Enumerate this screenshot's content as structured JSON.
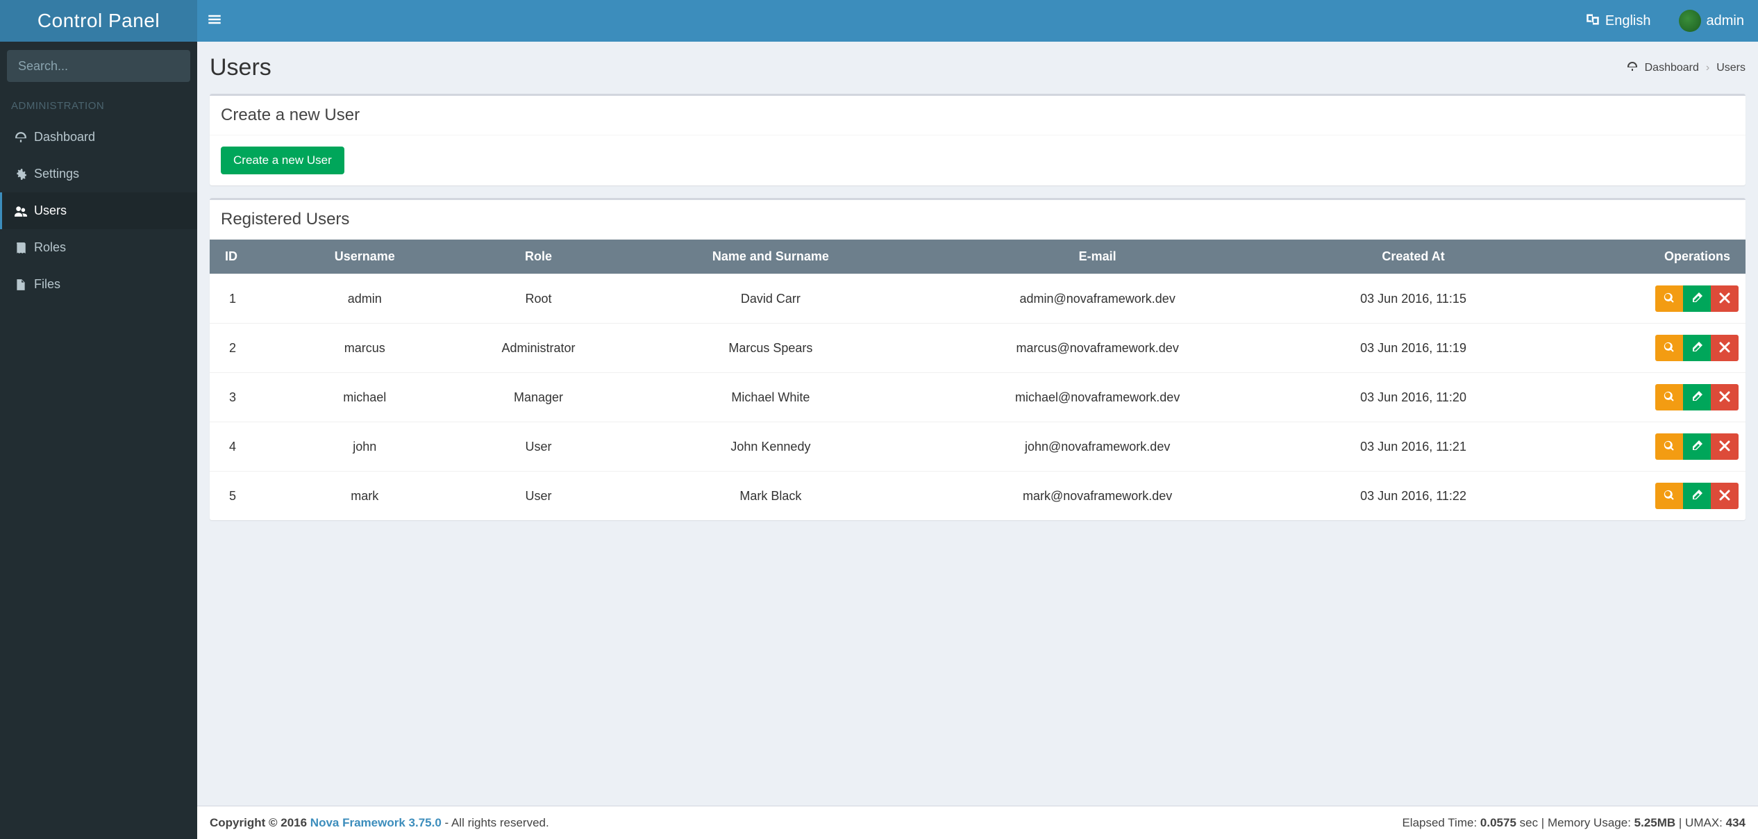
{
  "brand": "Control Panel",
  "search": {
    "placeholder": "Search..."
  },
  "sidebar": {
    "section": "ADMINISTRATION",
    "items": [
      {
        "label": "Dashboard",
        "icon": "dashboard"
      },
      {
        "label": "Settings",
        "icon": "gear"
      },
      {
        "label": "Users",
        "icon": "users",
        "active": true
      },
      {
        "label": "Roles",
        "icon": "book"
      },
      {
        "label": "Files",
        "icon": "file"
      }
    ]
  },
  "topbar": {
    "language": "English",
    "username": "admin"
  },
  "page": {
    "title": "Users",
    "breadcrumb": {
      "dashboard": "Dashboard",
      "current": "Users"
    }
  },
  "create_box": {
    "title": "Create a new User",
    "button": "Create a new User"
  },
  "table_box": {
    "title": "Registered Users",
    "columns": [
      "ID",
      "Username",
      "Role",
      "Name and Surname",
      "E-mail",
      "Created At",
      "Operations"
    ],
    "rows": [
      {
        "id": "1",
        "username": "admin",
        "role": "Root",
        "name": "David Carr",
        "email": "admin@novaframework.dev",
        "created": "03 Jun 2016, 11:15"
      },
      {
        "id": "2",
        "username": "marcus",
        "role": "Administrator",
        "name": "Marcus Spears",
        "email": "marcus@novaframework.dev",
        "created": "03 Jun 2016, 11:19"
      },
      {
        "id": "3",
        "username": "michael",
        "role": "Manager",
        "name": "Michael White",
        "email": "michael@novaframework.dev",
        "created": "03 Jun 2016, 11:20"
      },
      {
        "id": "4",
        "username": "john",
        "role": "User",
        "name": "John Kennedy",
        "email": "john@novaframework.dev",
        "created": "03 Jun 2016, 11:21"
      },
      {
        "id": "5",
        "username": "mark",
        "role": "User",
        "name": "Mark Black",
        "email": "mark@novaframework.dev",
        "created": "03 Jun 2016, 11:22"
      }
    ]
  },
  "footer": {
    "copyright_prefix": "Copyright © 2016 ",
    "framework": "Nova Framework 3.75.0",
    "rights": " - All rights reserved.",
    "stats_prefix": "Elapsed Time: ",
    "elapsed": "0.0575",
    "stats_mid1": " sec | Memory Usage: ",
    "memory": "5.25MB",
    "stats_mid2": " | UMAX: ",
    "umax": "434"
  },
  "icons": {
    "search": "search-icon",
    "view": "view-icon",
    "edit": "edit-icon",
    "delete": "delete-icon"
  }
}
